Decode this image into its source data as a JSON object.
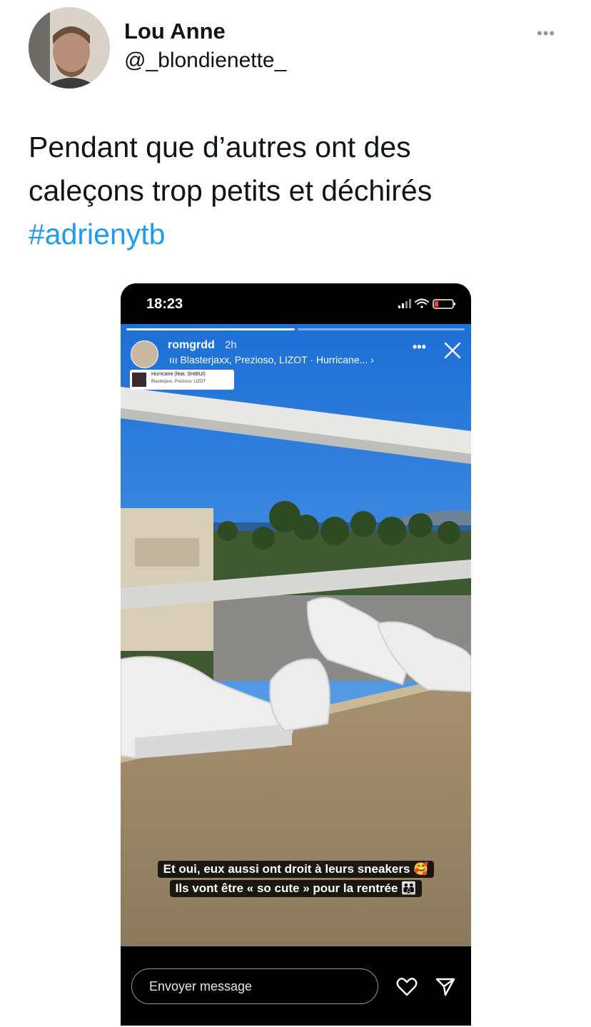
{
  "tweet": {
    "author_name": "Lou Anne",
    "author_handle": "@_blondienette_",
    "more_icon": "more-horizontal-icon",
    "text_line1": "Pendant que d’autres ont des",
    "text_line2": "caleçons trop petits et déchirés",
    "hashtag": "#adrienytb"
  },
  "story": {
    "status_time": "18:23",
    "status_icons": [
      "signal-icon",
      "wifi-icon",
      "battery-low-icon"
    ],
    "username": "romgrdd",
    "age": "2h",
    "music_line": "ııı Blasterjaxx, Prezioso, LIZOT · Hurricane... ›",
    "music_sticker": {
      "title": "Hurricane (feat. SHIBUI)",
      "artist": "Blasterjaxx, Prezioso, LIZOT"
    },
    "caption_line1": "Et oui, eux aussi ont droit à leurs sneakers 🥰",
    "caption_line2": "Ils vont être « so cute » pour la rentrée 👪",
    "reply_placeholder": "Envoyer message",
    "colors": {
      "hashtag": "#1d9bf0",
      "story_background": "#000000",
      "battery_low": "#ff3b30"
    }
  }
}
